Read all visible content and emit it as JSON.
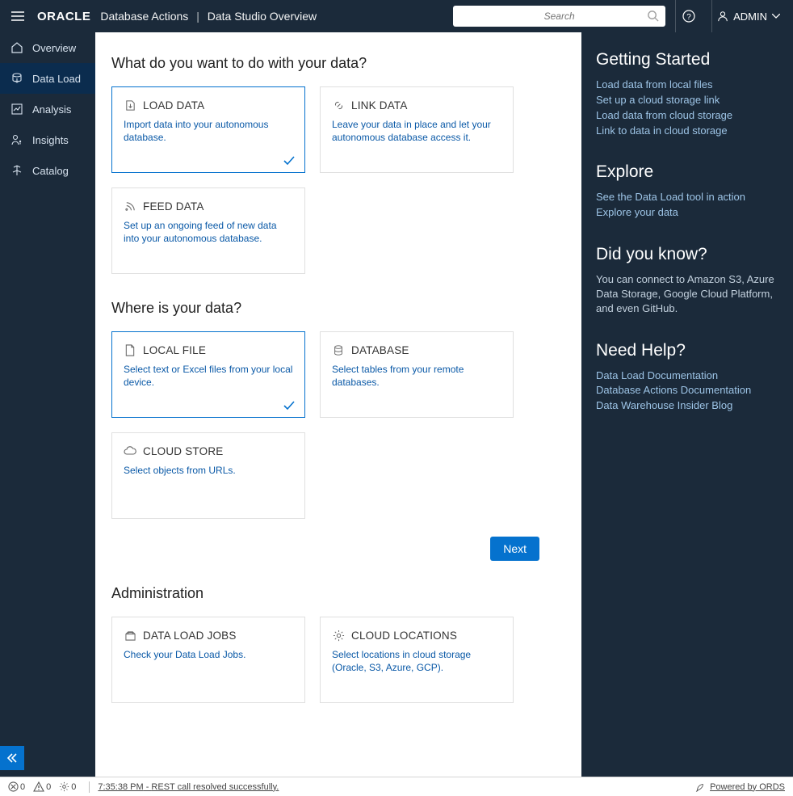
{
  "header": {
    "brand": "ORACLE",
    "title_left": "Database Actions",
    "title_right": "Data Studio Overview",
    "search_placeholder": "Search",
    "user": "ADMIN"
  },
  "sidebar": {
    "items": [
      {
        "id": "overview",
        "label": "Overview"
      },
      {
        "id": "data-load",
        "label": "Data Load"
      },
      {
        "id": "analysis",
        "label": "Analysis"
      },
      {
        "id": "insights",
        "label": "Insights"
      },
      {
        "id": "catalog",
        "label": "Catalog"
      }
    ]
  },
  "main": {
    "q1": "What do you want to do with your data?",
    "cards1": {
      "load": {
        "title": "LOAD DATA",
        "desc": "Import data into your autonomous database."
      },
      "link": {
        "title": "LINK DATA",
        "desc": "Leave your data in place and let your autonomous database access it."
      },
      "feed": {
        "title": "FEED DATA",
        "desc": "Set up an ongoing feed of new data into your autonomous database."
      }
    },
    "q2": "Where is your data?",
    "cards2": {
      "local": {
        "title": "LOCAL FILE",
        "desc": "Select text or Excel files from your local device."
      },
      "db": {
        "title": "DATABASE",
        "desc": "Select tables from your remote databases."
      },
      "cloud": {
        "title": "CLOUD STORE",
        "desc": "Select objects from URLs."
      }
    },
    "next": "Next",
    "q3": "Administration",
    "cards3": {
      "jobs": {
        "title": "DATA LOAD JOBS",
        "desc": "Check your Data Load Jobs."
      },
      "loc": {
        "title": "CLOUD LOCATIONS",
        "desc": "Select locations in cloud storage (Oracle, S3, Azure, GCP)."
      }
    }
  },
  "rpanel": {
    "getting_started": {
      "title": "Getting Started",
      "links": [
        "Load data from local files",
        "Set up a cloud storage link",
        "Load data from cloud storage",
        "Link to data in cloud storage"
      ]
    },
    "explore": {
      "title": "Explore",
      "links": [
        "See the Data Load tool in action",
        "Explore your data"
      ]
    },
    "dyk": {
      "title": "Did you know?",
      "text": "You can connect to Amazon S3, Azure Data Storage, Google Cloud Platform, and even GitHub."
    },
    "help": {
      "title": "Need Help?",
      "links": [
        "Data Load Documentation",
        "Database Actions Documentation",
        "Data Warehouse Insider Blog"
      ]
    }
  },
  "footer": {
    "errors": "0",
    "warnings": "0",
    "processes": "0",
    "time": "7:35:38 PM",
    "msg": "REST call resolved successfully.",
    "powered": "Powered by ORDS"
  }
}
